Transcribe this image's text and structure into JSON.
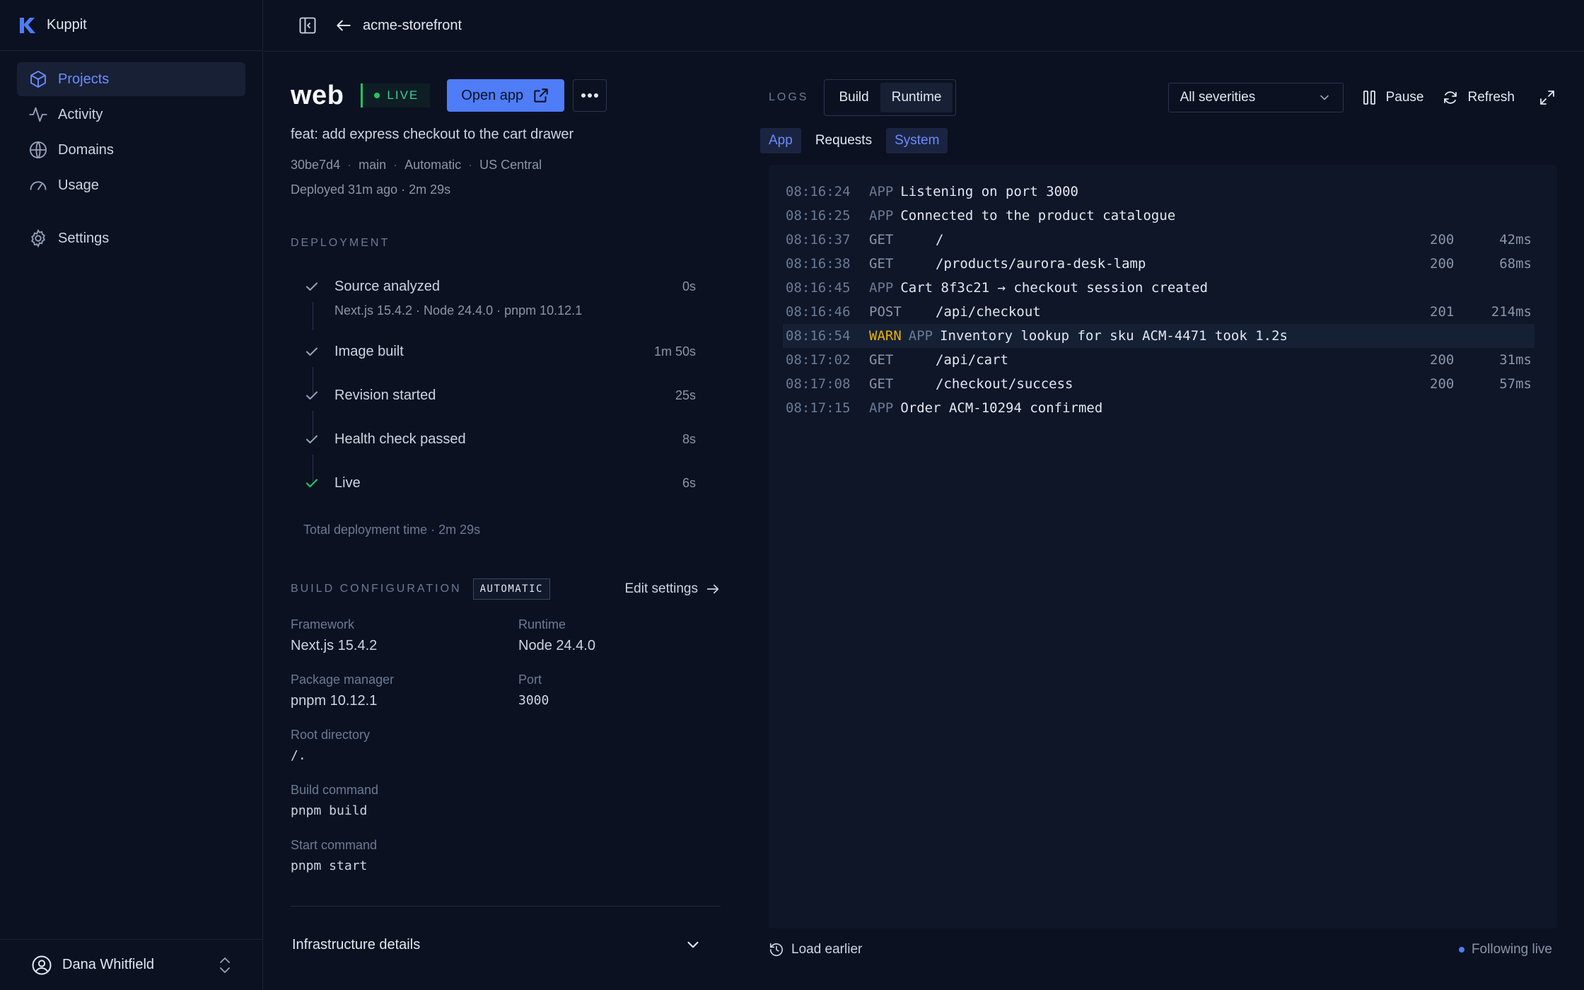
{
  "app": {
    "brand": "Kuppit"
  },
  "sidebar": {
    "items": [
      {
        "label": "Projects",
        "icon": "cube-icon",
        "active": true
      },
      {
        "label": "Activity",
        "icon": "activity-icon"
      },
      {
        "label": "Domains",
        "icon": "globe-icon"
      },
      {
        "label": "Usage",
        "icon": "gauge-icon"
      },
      {
        "label": "Settings",
        "icon": "gear-icon"
      }
    ],
    "user": {
      "name": "Dana Whitfield"
    }
  },
  "topbar": {
    "breadcrumb": "acme-storefront"
  },
  "service": {
    "name": "web",
    "status": "LIVE",
    "open_app_label": "Open app",
    "commit_message": "feat: add express checkout to the cart drawer",
    "meta": {
      "commit": "30be7d4",
      "branch": "main",
      "trigger": "Automatic",
      "region": "US Central"
    },
    "deployed": "Deployed 31m ago · 2m 29s"
  },
  "deployment": {
    "label": "DEPLOYMENT",
    "steps": [
      {
        "name": "Source analyzed",
        "duration": "0s",
        "detail": "Next.js 15.4.2 · Node 24.4.0 · pnpm 10.12.1"
      },
      {
        "name": "Image built",
        "duration": "1m 50s"
      },
      {
        "name": "Revision started",
        "duration": "25s"
      },
      {
        "name": "Health check passed",
        "duration": "8s"
      },
      {
        "name": "Live",
        "duration": "6s"
      }
    ],
    "total": "Total deployment time · 2m 29s"
  },
  "build_config": {
    "label": "BUILD CONFIGURATION",
    "mode_badge": "AUTOMATIC",
    "edit_label": "Edit settings",
    "framework": {
      "key": "Framework",
      "value": "Next.js 15.4.2"
    },
    "runtime": {
      "key": "Runtime",
      "value": "Node 24.4.0"
    },
    "package_manager": {
      "key": "Package manager",
      "value": "pnpm 10.12.1"
    },
    "port": {
      "key": "Port",
      "value": "3000"
    },
    "root_dir": {
      "key": "Root directory",
      "value": "/."
    },
    "build_cmd": {
      "key": "Build command",
      "value": "pnpm build"
    },
    "start_cmd": {
      "key": "Start command",
      "value": "pnpm start"
    }
  },
  "infrastructure": {
    "label": "Infrastructure details"
  },
  "logs": {
    "label": "LOGS",
    "tabs": [
      {
        "label": "Build"
      },
      {
        "label": "Runtime",
        "active": true
      }
    ],
    "severity": "All severities",
    "pause_label": "Pause",
    "refresh_label": "Refresh",
    "filters": [
      {
        "label": "App",
        "on": true
      },
      {
        "label": "Requests",
        "on": false
      },
      {
        "label": "System",
        "on": true
      }
    ],
    "lines": [
      {
        "ts": "08:16:24",
        "src": "APP",
        "msg": "Listening on port 3000"
      },
      {
        "ts": "08:16:25",
        "src": "APP",
        "msg": "Connected to the product catalogue"
      },
      {
        "ts": "08:16:37",
        "method": "GET",
        "path": "/",
        "code": "200",
        "latency": "42ms"
      },
      {
        "ts": "08:16:38",
        "method": "GET",
        "path": "/products/aurora-desk-lamp",
        "code": "200",
        "latency": "68ms"
      },
      {
        "ts": "08:16:45",
        "src": "APP",
        "msg": "Cart 8f3c21 → checkout session created"
      },
      {
        "ts": "08:16:46",
        "method": "POST",
        "path": "/api/checkout",
        "code": "201",
        "latency": "214ms"
      },
      {
        "ts": "08:16:54",
        "level": "WARN",
        "src": "APP",
        "msg": "Inventory lookup for sku ACM-4471 took 1.2s"
      },
      {
        "ts": "08:17:02",
        "method": "GET",
        "path": "/api/cart",
        "code": "200",
        "latency": "31ms"
      },
      {
        "ts": "08:17:08",
        "method": "GET",
        "path": "/checkout/success",
        "code": "200",
        "latency": "57ms"
      },
      {
        "ts": "08:17:15",
        "src": "APP",
        "msg": "Order ACM-10294 confirmed"
      }
    ],
    "load_earlier": "Load earlier",
    "following": "Following live"
  },
  "colors": {
    "accent": "#4f7cf7",
    "live": "#22c55e",
    "warn": "#eab308",
    "background": "#0b1121"
  }
}
